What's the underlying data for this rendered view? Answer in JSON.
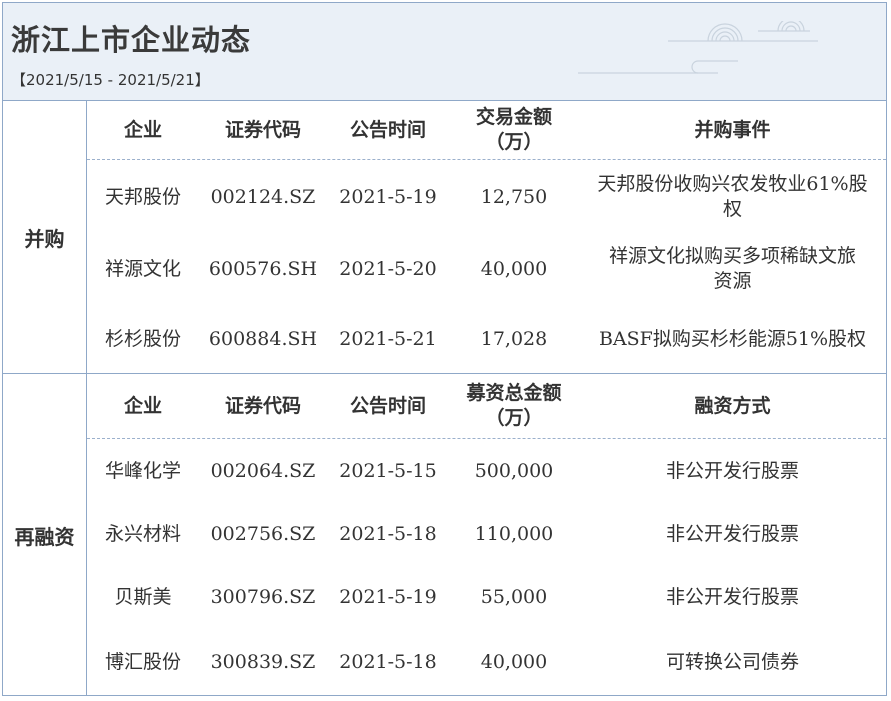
{
  "header": {
    "title": "浙江上市企业动态",
    "date_range": "【2021/5/15 - 2021/5/21】"
  },
  "mna": {
    "label": "并购",
    "headers": [
      "企业",
      "证券代码",
      "公告时间",
      "交易金额\n（万）",
      "并购事件"
    ],
    "rows": [
      [
        "天邦股份",
        "002124.SZ",
        "2021-5-19",
        "12,750",
        "天邦股份收购兴农发牧业61%股\n权"
      ],
      [
        "祥源文化",
        "600576.SH",
        "2021-5-20",
        "40,000",
        "祥源文化拟购买多项稀缺文旅\n资源"
      ],
      [
        "杉杉股份",
        "600884.SH",
        "2021-5-21",
        "17,028",
        "BASF拟购买杉杉能源51%股权"
      ]
    ]
  },
  "refinance": {
    "label": "再融资",
    "headers": [
      "企业",
      "证券代码",
      "公告时间",
      "募资总金额\n（万）",
      "融资方式"
    ],
    "rows": [
      [
        "华峰化学",
        "002064.SZ",
        "2021-5-15",
        "500,000",
        "非公开发行股票"
      ],
      [
        "永兴材料",
        "002756.SZ",
        "2021-5-18",
        "110,000",
        "非公开发行股票"
      ],
      [
        "贝斯美",
        "300796.SZ",
        "2021-5-19",
        "55,000",
        "非公开发行股票"
      ],
      [
        "博汇股份",
        "300839.SZ",
        "2021-5-18",
        "40,000",
        "可转换公司债券"
      ]
    ]
  }
}
